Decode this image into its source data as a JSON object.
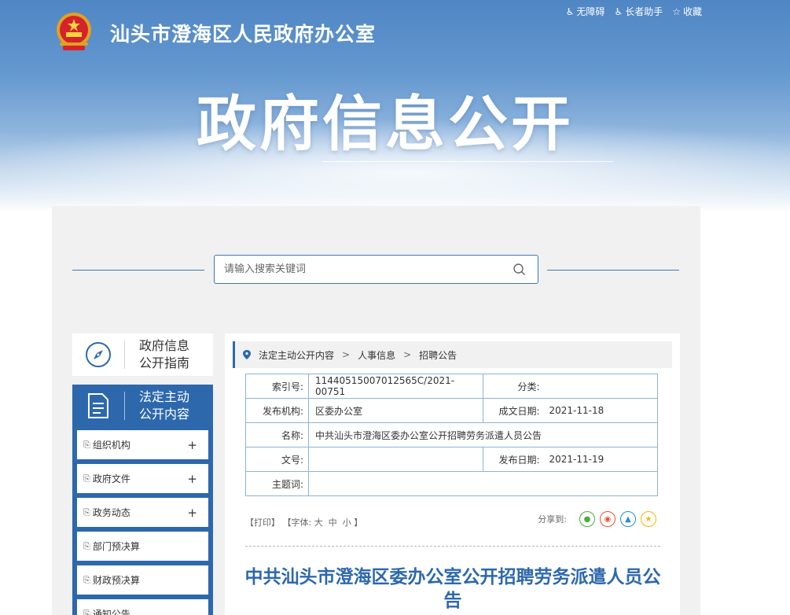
{
  "header": {
    "site_title": "汕头市澄海区人民政府办公室",
    "big_title": "政府信息公开",
    "links": [
      {
        "icon": "accessibility-icon",
        "label": "无障碍"
      },
      {
        "icon": "elder-helper-icon",
        "label": "长者助手"
      },
      {
        "icon": "star-icon",
        "label": "收藏"
      }
    ]
  },
  "search": {
    "placeholder": "请输入搜索关键词"
  },
  "sidebar": {
    "guide_label": "政府信息\n公开指南",
    "active_label": "法定主动\n公开内容",
    "menu": [
      {
        "label": "组织机构",
        "expandable": true
      },
      {
        "label": "政府文件",
        "expandable": true
      },
      {
        "label": "政务动态",
        "expandable": true
      },
      {
        "label": "部门预决算",
        "expandable": false
      },
      {
        "label": "财政预决算",
        "expandable": false
      },
      {
        "label": "通知公告",
        "expandable": false
      }
    ]
  },
  "breadcrumb": [
    "法定主动公开内容",
    "人事信息",
    "招聘公告"
  ],
  "meta": {
    "index_label": "索引号:",
    "index_value": "11440515007012565C/2021-00751",
    "category_label": "分类:",
    "category_value": "",
    "publisher_label": "发布机构:",
    "publisher_value": "区委办公室",
    "created_label": "成文日期:",
    "created_value": "2021-11-18",
    "name_label": "名称:",
    "name_value": "中共汕头市澄海区委办公室公开招聘劳务派遣人员公告",
    "docno_label": "文号:",
    "docno_value": "",
    "published_label": "发布日期:",
    "published_value": "2021-11-19",
    "subject_label": "主题词:",
    "subject_value": ""
  },
  "tools": {
    "print": "【打印】",
    "font_prefix": "【字体:",
    "font_large": "大",
    "font_medium": "中",
    "font_small": "小",
    "font_suffix": "】",
    "share_label": "分享到:"
  },
  "article": {
    "title": "中共汕头市澄海区委办公室公开招聘劳务派遣人员公告"
  },
  "colors": {
    "primary": "#2d68ad",
    "wechat": "#4caf3c",
    "weibo": "#e5532d",
    "qq": "#2b8ad6",
    "qzone": "#f2b705"
  }
}
